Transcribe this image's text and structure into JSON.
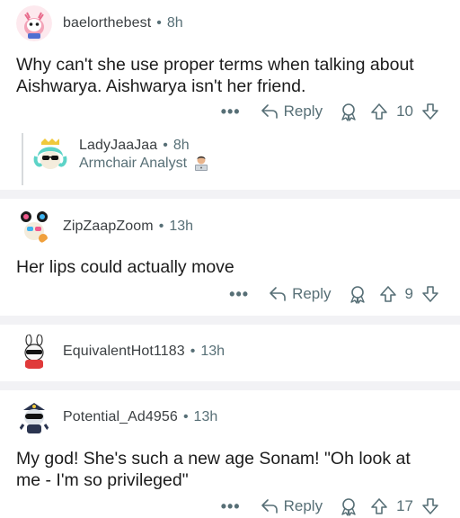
{
  "comments": [
    {
      "username": "baelorthebest",
      "time": "8h",
      "text_lines": [
        "Why can't she use proper terms when talking about",
        "Aishwarya. Aishwarya isn't her friend."
      ],
      "more": "•••",
      "reply_label": "Reply",
      "votes": "10"
    },
    {
      "username": "LadyJaaJaa",
      "time": "8h",
      "flair": "Armchair Analyst"
    },
    {
      "username": "ZipZaapZoom",
      "time": "13h",
      "text_lines": [
        "Her lips could actually move"
      ],
      "more": "•••",
      "reply_label": "Reply",
      "votes": "9"
    },
    {
      "username": "EquivalentHot1183",
      "time": "13h"
    },
    {
      "username": "Potential_Ad4956",
      "time": "13h",
      "text_lines": [
        "My god! She's such a new age Sonam! \"Oh look at",
        "me - I'm so privileged\""
      ],
      "more": "•••",
      "reply_label": "Reply",
      "votes": "17"
    }
  ],
  "separator": "•",
  "colors": {
    "meta_gray": "#576f76",
    "divider": "#f2f2f5",
    "text": "#1c1c1c"
  },
  "icons": [
    "reply-arrow-icon",
    "award-icon",
    "upvote-icon",
    "downvote-icon",
    "more-dots-icon"
  ]
}
